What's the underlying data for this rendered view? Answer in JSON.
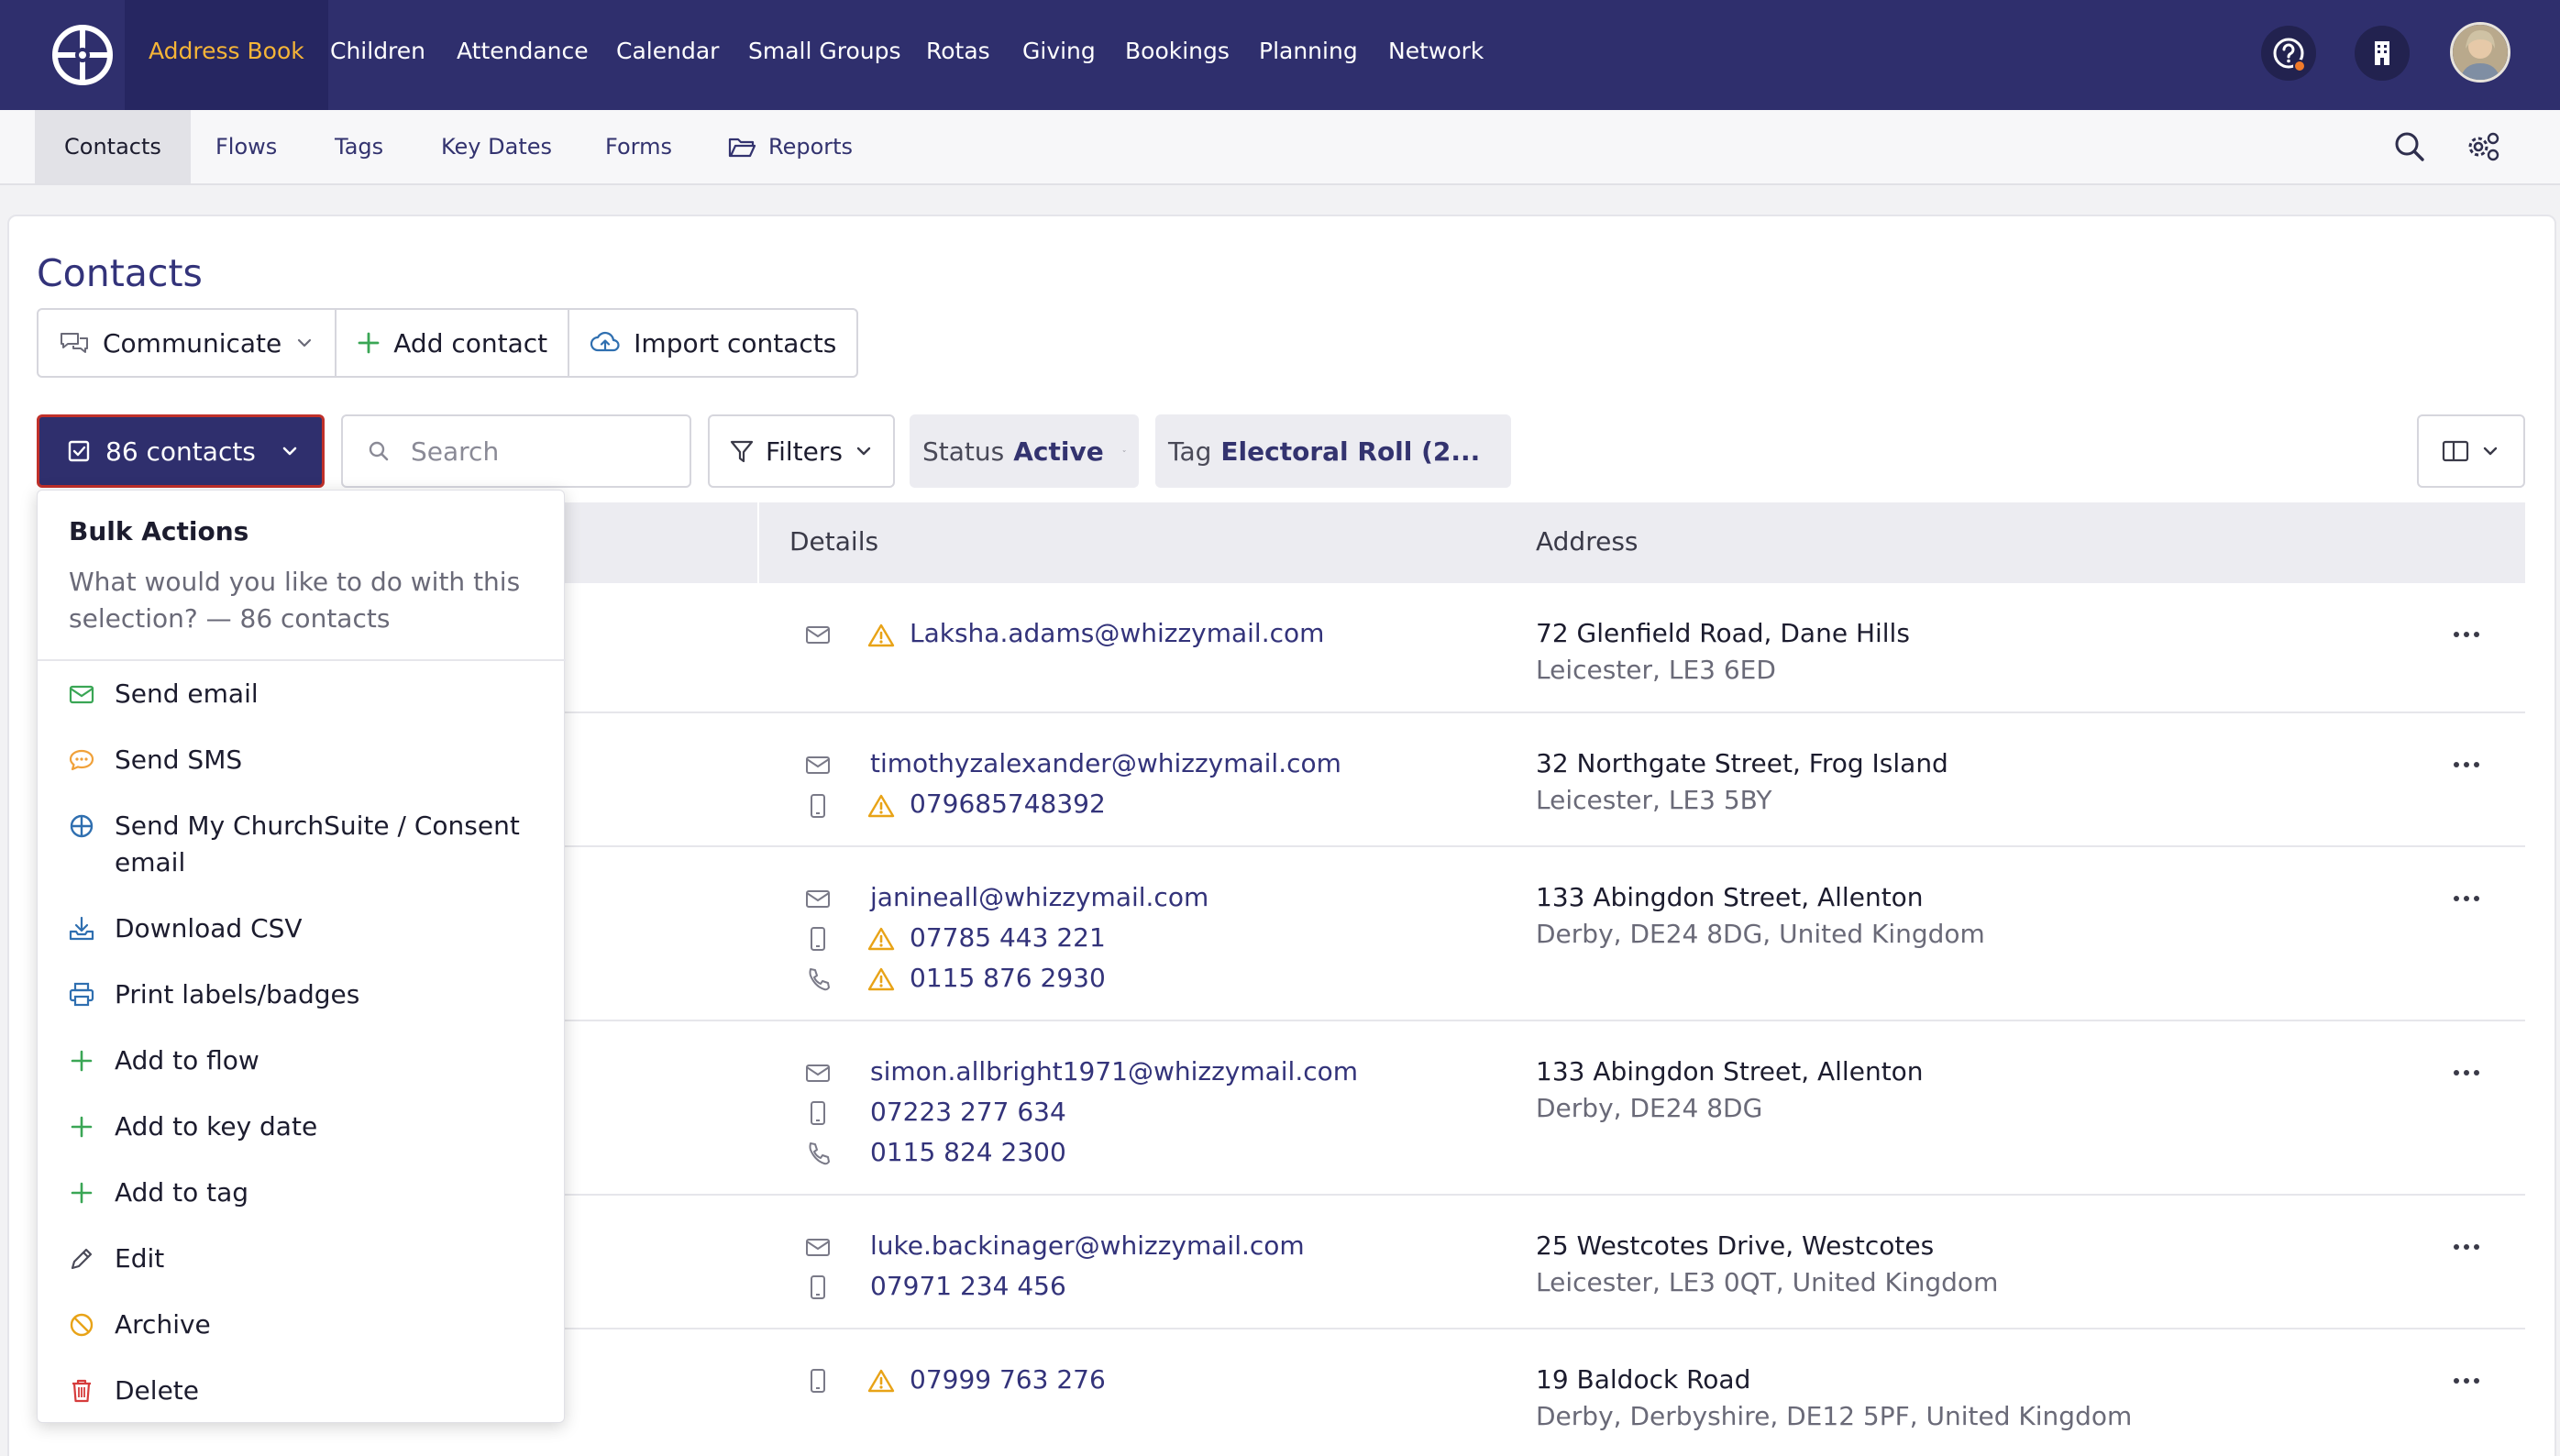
{
  "topnav": {
    "items": [
      "Address Book",
      "Children",
      "Attendance",
      "Calendar",
      "Small Groups",
      "Rotas",
      "Giving",
      "Bookings",
      "Planning",
      "Network"
    ],
    "active": "Address Book",
    "icons": [
      "churchsuite-logo-icon",
      "help-icon",
      "organisation-icon",
      "user-avatar"
    ]
  },
  "subnav": {
    "items": [
      "Contacts",
      "Flows",
      "Tags",
      "Key Dates",
      "Forms",
      "Reports"
    ],
    "active": "Contacts",
    "icons": [
      "folder-icon",
      "search-icon",
      "settings-icon"
    ]
  },
  "page": {
    "title": "Contacts",
    "actions": {
      "communicate": "Communicate",
      "add": "Add contact",
      "import": "Import contacts"
    }
  },
  "toolbar": {
    "selection_label": "86 contacts",
    "search_placeholder": "Search",
    "filters_label": "Filters",
    "status_chip": {
      "key": "Status",
      "value": "Active"
    },
    "tag_chip": {
      "key": "Tag",
      "value": "Electoral Roll (2..."
    }
  },
  "table": {
    "headers": {
      "details": "Details",
      "address": "Address"
    },
    "rows": [
      {
        "email": "Laksha.adams@whizzymail.com",
        "address_line1": "72 Glenfield Road, Dane Hills",
        "address_line2": "Leicester, LE3 6ED"
      },
      {
        "email": "timothyzalexander@whizzymail.com",
        "mobile": "079685748392",
        "address_line1": "32 Northgate Street, Frog Island",
        "address_line2": "Leicester, LE3 5BY"
      },
      {
        "email": "janineall@whizzymail.com",
        "mobile": "07785 443 221",
        "phone": "0115 876 2930",
        "address_line1": "133 Abingdon Street, Allenton",
        "address_line2": "Derby, DE24 8DG, United Kingdom"
      },
      {
        "email": "simon.allbright1971@whizzymail.com",
        "mobile": "07223 277 634",
        "phone": "0115 824 2300",
        "address_line1": "133 Abingdon Street, Allenton",
        "address_line2": "Derby, DE24 8DG"
      },
      {
        "email": "luke.backinager@whizzymail.com",
        "mobile": "07971 234 456",
        "address_line1": "25 Westcotes Drive, Westcotes",
        "address_line2": "Leicester, LE3 0QT, United Kingdom"
      },
      {
        "mobile": "07999 763 276",
        "address_line1": "19 Baldock Road",
        "address_line2": "Derby, Derbyshire, DE12 5PF, United Kingdom"
      }
    ]
  },
  "bulk_actions": {
    "title": "Bulk Actions",
    "subtitle": "What would you like to do with this selection? — 86 contacts",
    "items": [
      {
        "label": "Send email",
        "icon": "envelope-icon"
      },
      {
        "label": "Send SMS",
        "icon": "sms-icon"
      },
      {
        "label": "Send My ChurchSuite / Consent email",
        "icon": "churchsuite-icon"
      },
      {
        "label": "Download CSV",
        "icon": "download-icon"
      },
      {
        "label": "Print labels/badges",
        "icon": "printer-icon"
      },
      {
        "label": "Add to flow",
        "icon": "plus-icon"
      },
      {
        "label": "Add to key date",
        "icon": "plus-icon"
      },
      {
        "label": "Add to tag",
        "icon": "plus-icon"
      },
      {
        "label": "Edit",
        "icon": "pencil-icon"
      },
      {
        "label": "Archive",
        "icon": "archive-icon"
      },
      {
        "label": "Delete",
        "icon": "trash-icon"
      }
    ]
  },
  "colors": {
    "nav_bg": "#2f2f6d",
    "accent": "#f6b537",
    "link": "#33337a",
    "warning": "#e8a317",
    "success": "#3aa655",
    "danger": "#d63c3c"
  }
}
